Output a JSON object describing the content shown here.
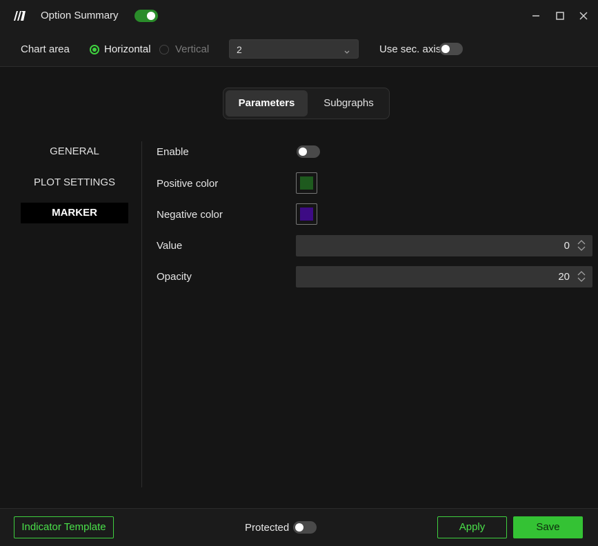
{
  "window": {
    "title": "Option Summary",
    "title_toggle_on": true
  },
  "toolbar": {
    "chart_area_label": "Chart area",
    "orientation_options": [
      {
        "label": "Horizontal",
        "selected": true
      },
      {
        "label": "Vertical",
        "selected": false
      }
    ],
    "pane_value": "2",
    "sec_axis_label": "Use sec. axis",
    "sec_axis_on": false
  },
  "tabs": [
    {
      "label": "Parameters",
      "active": true
    },
    {
      "label": "Subgraphs",
      "active": false
    }
  ],
  "sidebar": {
    "items": [
      {
        "label": "GENERAL",
        "active": false
      },
      {
        "label": "PLOT SETTINGS",
        "active": false
      },
      {
        "label": "MARKER",
        "active": true
      }
    ]
  },
  "marker": {
    "enable_label": "Enable",
    "enable_on": false,
    "positive_color_label": "Positive color",
    "positive_color": "#1e5a1e",
    "negative_color_label": "Negative color",
    "negative_color": "#3d0b84",
    "value_label": "Value",
    "value": "0",
    "opacity_label": "Opacity",
    "opacity": "20"
  },
  "footer": {
    "indicator_template_label": "Indicator Template",
    "protected_label": "Protected",
    "protected_on": false,
    "apply_label": "Apply",
    "save_label": "Save"
  },
  "colors": {
    "accent": "#3fd13f",
    "background": "#151515",
    "panel": "#1b1b1b"
  },
  "icons": {
    "app_logo": "app-logo-icon",
    "minimize": "minimize-icon",
    "maximize": "maximize-icon",
    "close": "close-icon",
    "dropdown": "chevron-down-icon",
    "spinner": "spin-up-down-icon"
  }
}
